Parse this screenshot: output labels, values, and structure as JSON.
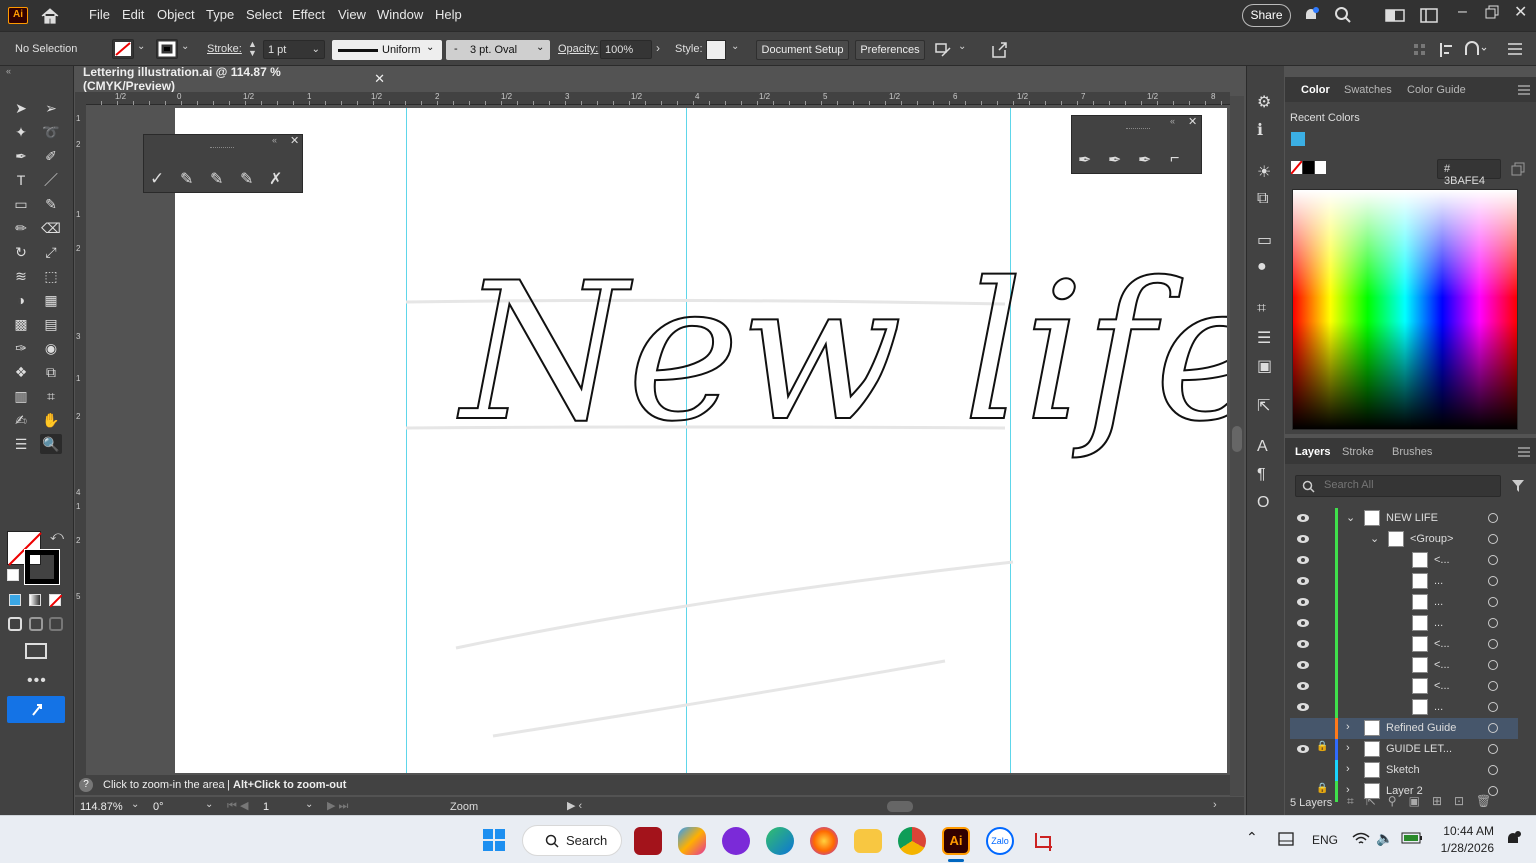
{
  "menubar": {
    "logo": "Ai",
    "items": [
      "File",
      "Edit",
      "Object",
      "Type",
      "Select",
      "Effect",
      "View",
      "Window",
      "Help"
    ],
    "share": "Share"
  },
  "control": {
    "selection": "No Selection",
    "stroke_label": "Stroke:",
    "stroke_value": "1 pt",
    "profile": "Uniform",
    "brush": "3 pt. Oval",
    "opacity_label": "Opacity:",
    "opacity_value": "100%",
    "style_label": "Style:",
    "doc_setup": "Document Setup",
    "preferences": "Preferences"
  },
  "document": {
    "tab_title": "Lettering illustration.ai @ 114.87 % (CMYK/Preview)",
    "artwork_text": "New life"
  },
  "ruler_h": [
    "1/2",
    "0",
    "1/2",
    "1",
    "1/2",
    "2",
    "1/2",
    "3",
    "1/2",
    "4",
    "1/2",
    "5",
    "1/2",
    "6",
    "1/2",
    "7",
    "1/2",
    "8"
  ],
  "ruler_v": [
    "1",
    "2",
    "1",
    "2",
    "3",
    "1",
    "2",
    "4",
    "1",
    "2",
    "5"
  ],
  "status": {
    "hint": "Click to zoom-in the area",
    "hint2": "Alt+Click to zoom-out",
    "zoom": "114.87%",
    "rotation": "0°",
    "artboard": "1",
    "tool": "Zoom"
  },
  "color_panel": {
    "tabs": [
      "Color",
      "Swatches",
      "Color Guide"
    ],
    "recent_label": "Recent Colors",
    "hex": "3BAFE4",
    "recent_color": "#3BAFE4"
  },
  "layers_panel": {
    "tabs": [
      "Layers",
      "Stroke",
      "Brushes"
    ],
    "search_placeholder": "Search All",
    "count": "5 Layers",
    "rows": [
      {
        "name": "NEW LIFE",
        "indent": 0,
        "expanded": true,
        "eye": true,
        "lock": false,
        "color": "#3fe04b"
      },
      {
        "name": "<Group>",
        "indent": 1,
        "expanded": true,
        "eye": true,
        "lock": false,
        "color": "#3fe04b"
      },
      {
        "name": "<...",
        "indent": 2,
        "eye": true,
        "lock": false,
        "color": "#3fe04b"
      },
      {
        "name": "...",
        "indent": 2,
        "eye": true,
        "lock": false,
        "color": "#3fe04b"
      },
      {
        "name": "...",
        "indent": 2,
        "eye": true,
        "lock": false,
        "color": "#3fe04b"
      },
      {
        "name": "...",
        "indent": 2,
        "eye": true,
        "lock": false,
        "color": "#3fe04b"
      },
      {
        "name": "<...",
        "indent": 2,
        "eye": true,
        "lock": false,
        "color": "#3fe04b"
      },
      {
        "name": "<...",
        "indent": 2,
        "eye": true,
        "lock": false,
        "color": "#3fe04b"
      },
      {
        "name": "<...",
        "indent": 2,
        "eye": true,
        "lock": false,
        "color": "#3fe04b"
      },
      {
        "name": "...",
        "indent": 2,
        "eye": true,
        "lock": false,
        "color": "#3fe04b"
      },
      {
        "name": "Refined Guide",
        "indent": 0,
        "expanded": false,
        "eye": false,
        "lock": false,
        "color": "#ff7a1a",
        "selected": true
      },
      {
        "name": "GUIDE LET...",
        "indent": 0,
        "expanded": false,
        "eye": true,
        "lock": true,
        "color": "#2f6bff"
      },
      {
        "name": "Sketch",
        "indent": 0,
        "expanded": false,
        "eye": false,
        "lock": false,
        "color": "#19d4ff"
      },
      {
        "name": "Layer 2",
        "indent": 0,
        "expanded": false,
        "eye": false,
        "lock": true,
        "color": "#3fe04b"
      }
    ]
  },
  "taskbar": {
    "search": "Search",
    "lang": "ENG",
    "time": "10:44 AM",
    "date": "1/28/2026"
  }
}
